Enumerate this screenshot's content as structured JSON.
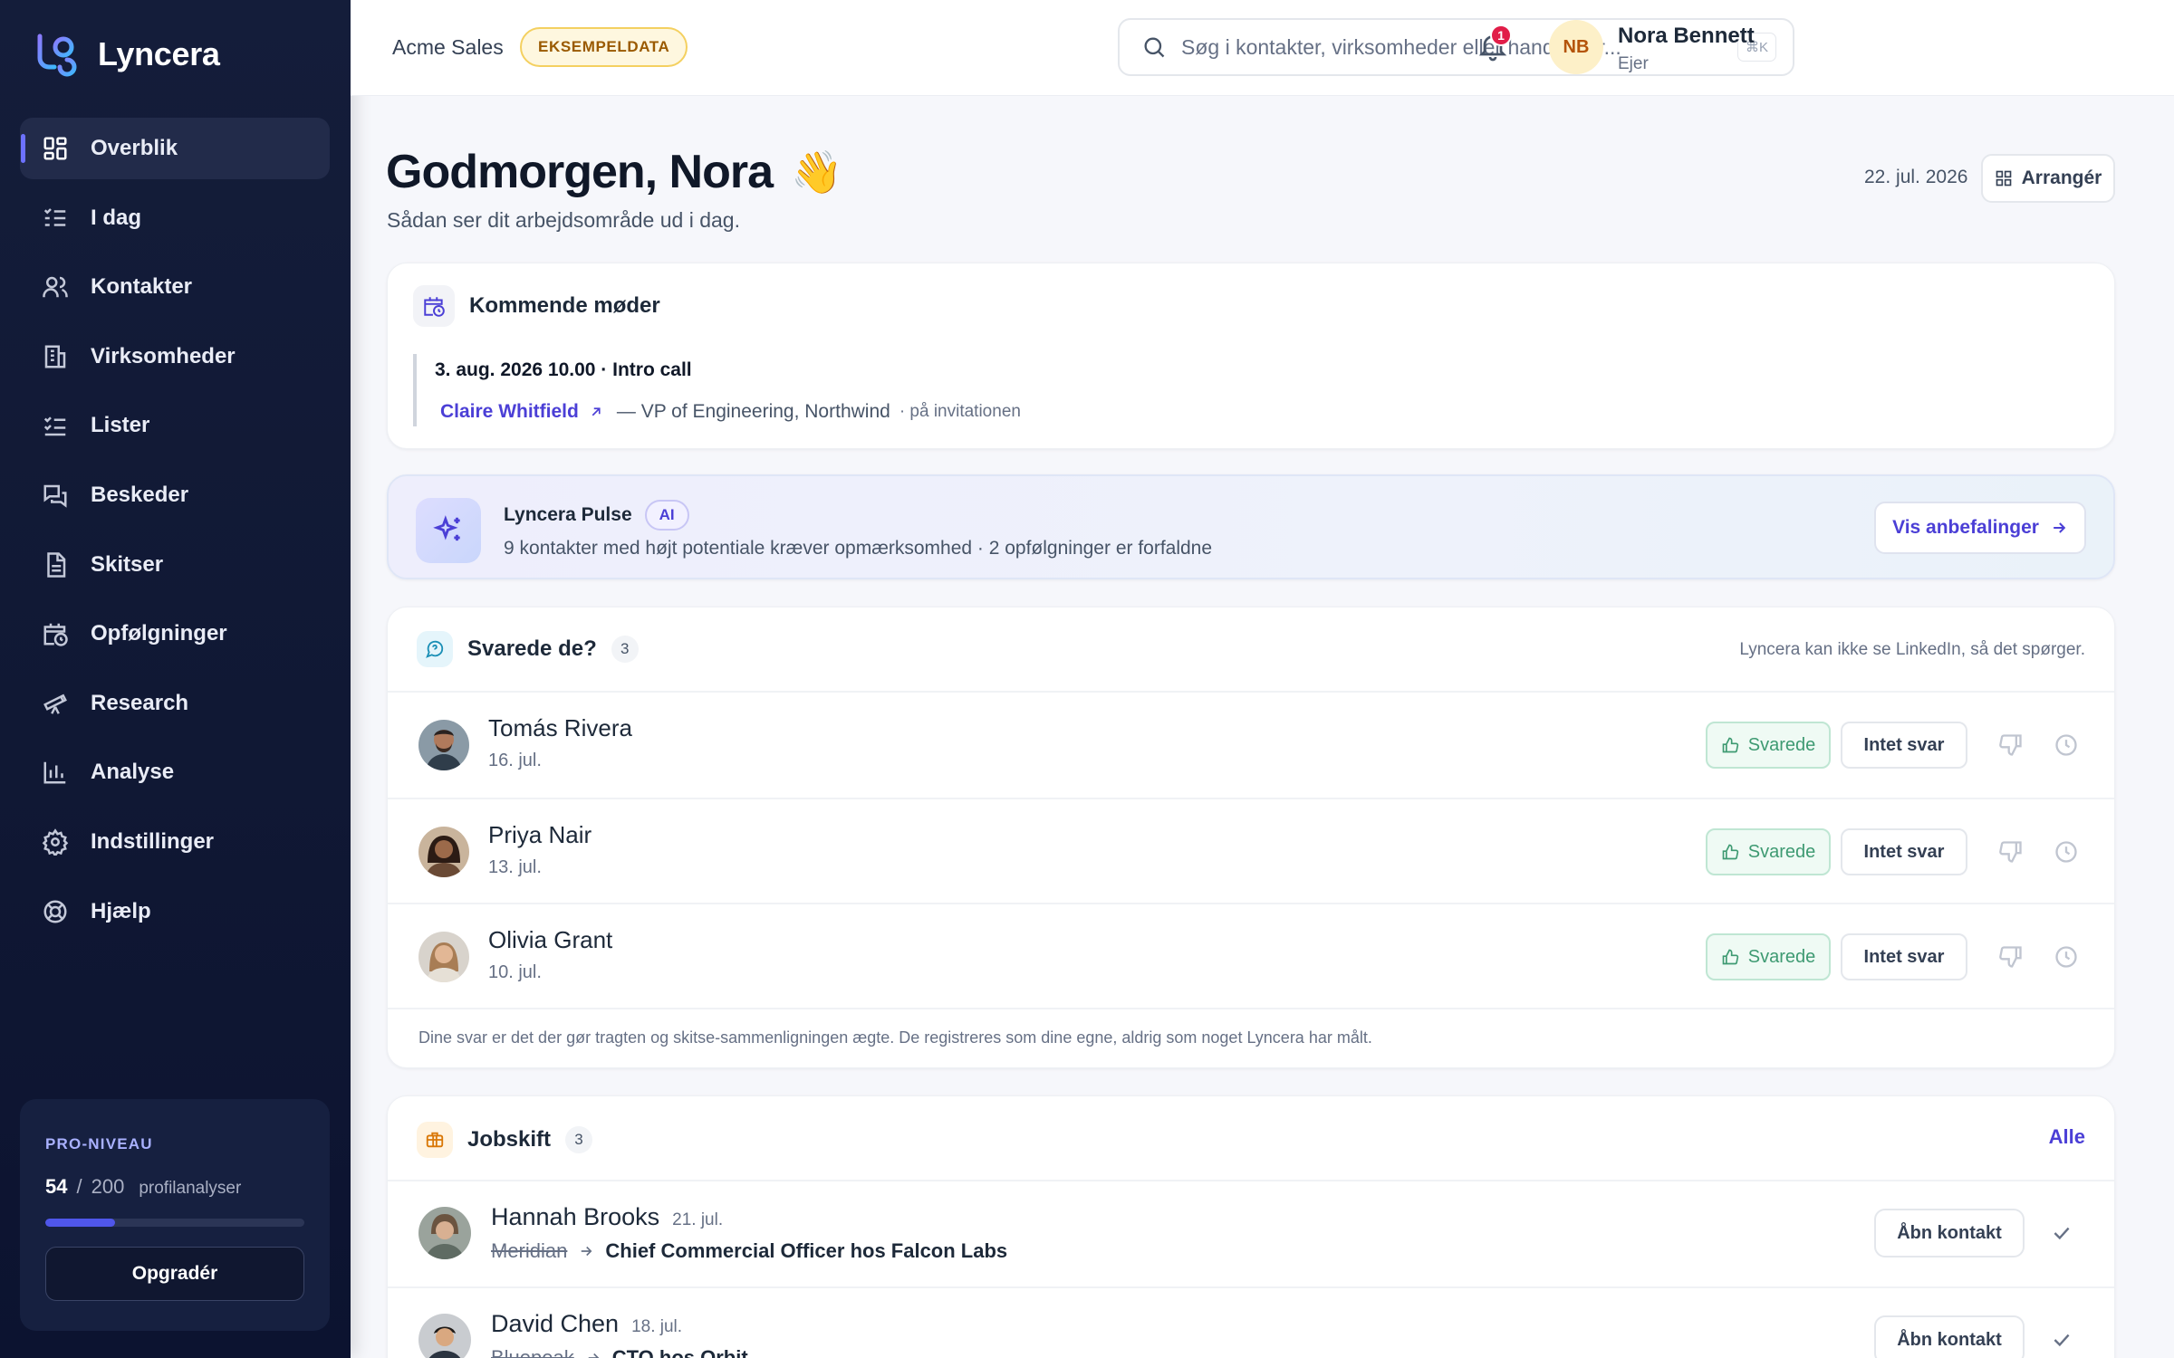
{
  "app": {
    "name": "Lyncera"
  },
  "sidebar": {
    "items": [
      {
        "label": "Overblik",
        "icon": "grid-icon",
        "active": true
      },
      {
        "label": "I dag",
        "icon": "checklist-icon"
      },
      {
        "label": "Kontakter",
        "icon": "users-icon"
      },
      {
        "label": "Virksomheder",
        "icon": "building-icon"
      },
      {
        "label": "Lister",
        "icon": "list-icon"
      },
      {
        "label": "Beskeder",
        "icon": "messages-icon"
      },
      {
        "label": "Skitser",
        "icon": "document-icon"
      },
      {
        "label": "Opfølgninger",
        "icon": "calendar-clock-icon"
      },
      {
        "label": "Research",
        "icon": "telescope-icon"
      },
      {
        "label": "Analyse",
        "icon": "bar-chart-icon"
      },
      {
        "label": "Indstillinger",
        "icon": "gear-icon"
      },
      {
        "label": "Hjælp",
        "icon": "lifebuoy-icon"
      }
    ],
    "plan": {
      "title": "PRO-NIVEAU",
      "used": "54",
      "separator": "/",
      "total": "200",
      "unit": "profilanalyser",
      "progress": 0.27,
      "upgrade_label": "Opgradér"
    }
  },
  "topbar": {
    "workspace": "Acme Sales",
    "sample_badge": "EKSEMPELDATA",
    "search_placeholder": "Søg i kontakter, virksomheder eller handlinger...",
    "shortcut": "⌘K",
    "notifications": "1",
    "user": {
      "initials": "NB",
      "name": "Nora Bennett",
      "role": "Ejer"
    }
  },
  "main": {
    "greeting": "Godmorgen, Nora",
    "greeting_emoji": "👋",
    "subtitle": "Sådan ser dit arbejdsområde ud i dag.",
    "date": "22. jul. 2026",
    "arrange_label": "Arrangér"
  },
  "meetings": {
    "title": "Kommende møder",
    "item": {
      "when_title": "3. aug. 2026 10.00 · Intro call",
      "contact": "Claire Whitfield",
      "role": "— VP of Engineering, Northwind",
      "note": "· på invitationen"
    }
  },
  "pulse": {
    "title": "Lyncera Pulse",
    "badge": "AI",
    "text": "9 kontakter med højt potentiale kræver opmærksomhed · 2 opfølgninger er forfaldne",
    "button": "Vis anbefalinger"
  },
  "replies": {
    "title": "Svarede de?",
    "count": "3",
    "note": "Lyncera kan ikke se LinkedIn, så det spørger.",
    "reply_label": "Svarede",
    "noreply_label": "Intet svar",
    "rows": [
      {
        "name": "Tomás Rivera",
        "date": "16. jul."
      },
      {
        "name": "Priya Nair",
        "date": "13. jul."
      },
      {
        "name": "Olivia Grant",
        "date": "10. jul."
      }
    ],
    "footer": "Dine svar er det der gør tragten og skitse-sammenligningen ægte. De registreres som dine egne, aldrig som noget Lyncera har målt."
  },
  "jobs": {
    "title": "Jobskift",
    "count": "3",
    "all_label": "Alle",
    "open_label": "Åbn kontakt",
    "rows": [
      {
        "name": "Hannah Brooks",
        "date": "21. jul.",
        "from": "Meridian",
        "to": "Chief Commercial Officer hos Falcon Labs"
      },
      {
        "name": "David Chen",
        "date": "18. jul.",
        "from": "Bluepeak",
        "to": "CTO hos Orbit"
      }
    ]
  },
  "colors": {
    "accent": "#4b3fd6",
    "sidebar_bg": "#141d3a",
    "success": "#3e9a72"
  }
}
